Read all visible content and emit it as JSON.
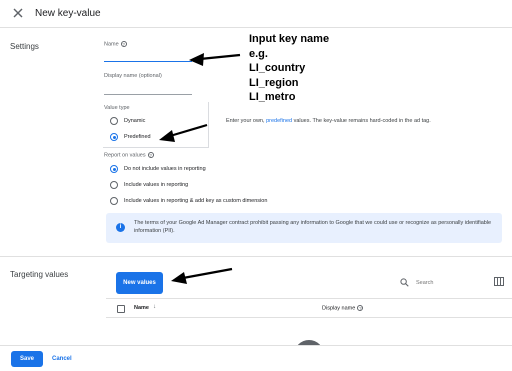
{
  "header": {
    "title": "New key-value",
    "close_icon": "close-icon"
  },
  "settings": {
    "section_label": "Settings",
    "name_label": "Name",
    "name_value": "",
    "display_name_label": "Display name (optional)",
    "display_name_value": "",
    "value_type_label": "Value type",
    "value_type_options": [
      {
        "label": "Dynamic",
        "checked": false
      },
      {
        "label": "Predefined",
        "checked": true
      }
    ],
    "report_label": "Report on values",
    "report_options": [
      {
        "label": "Do not include values in reporting",
        "checked": true
      },
      {
        "label": "Include values in reporting",
        "checked": false
      },
      {
        "label": "Include values in reporting & add key as custom dimension",
        "checked": false
      }
    ],
    "hint_prefix": "Enter your own,",
    "hint_link": "predefined",
    "hint_suffix": "values. The key-value remains hard-coded in the ad tag.",
    "info_text": "The terms of your Google Ad Manager contract prohibit passing any information to Google that we could use or recognize as personally identifiable information (PII)."
  },
  "annotation": {
    "lines": [
      "Input key name",
      "e.g.",
      "LI_country",
      "LI_region",
      "LI_metro"
    ]
  },
  "targeting": {
    "section_label": "Targeting values",
    "new_values_label": "New values",
    "search_placeholder": "Search",
    "columns": {
      "name": "Name",
      "display_name": "Display name"
    }
  },
  "footer": {
    "save_label": "Save",
    "cancel_label": "Cancel"
  },
  "colors": {
    "accent": "#1a73e8",
    "banner_bg": "#e8f0fe",
    "text": "#202124"
  }
}
